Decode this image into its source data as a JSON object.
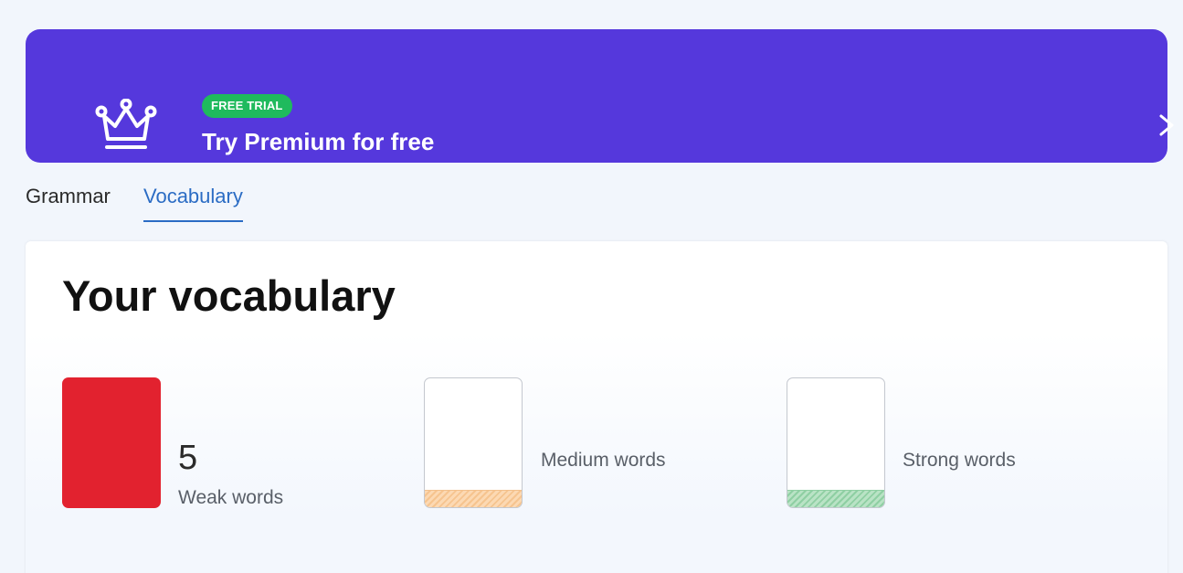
{
  "banner": {
    "badge": "FREE TRIAL",
    "title": "Try Premium for free",
    "icon": "crown-icon",
    "chevron_icon": "chevron-right-icon",
    "color": "#5538dc",
    "badge_color": "#1fba5d"
  },
  "tabs": [
    {
      "label": "Grammar",
      "active": false
    },
    {
      "label": "Vocabulary",
      "active": true
    }
  ],
  "vocabulary": {
    "heading": "Your vocabulary",
    "stats": [
      {
        "count": "5",
        "label": "Weak words",
        "color": "#e2222f",
        "level": 1.0
      },
      {
        "count": "",
        "label": "Medium words",
        "color": "#f6c48f",
        "level": 0.13
      },
      {
        "count": "",
        "label": "Strong words",
        "color": "#8fcfa3",
        "level": 0.13
      }
    ]
  }
}
